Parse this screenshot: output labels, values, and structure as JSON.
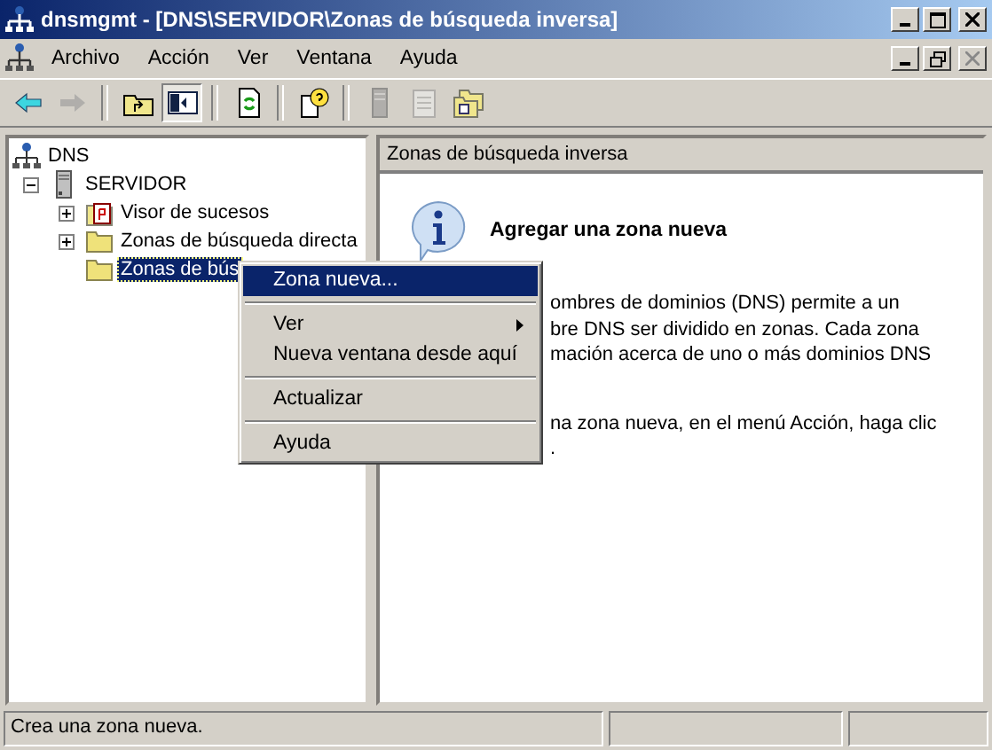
{
  "window": {
    "title": "dnsmgmt - [DNS\\SERVIDOR\\Zonas de búsqueda inversa]"
  },
  "menu_bar": [
    {
      "label": "Archivo"
    },
    {
      "label": "Acción"
    },
    {
      "label": "Ver"
    },
    {
      "label": "Ventana"
    },
    {
      "label": "Ayuda"
    }
  ],
  "toolbar": [
    {
      "kind": "back",
      "disabled": false,
      "pressed": false
    },
    {
      "kind": "forward",
      "disabled": true,
      "pressed": false
    },
    {
      "kind": "sep"
    },
    {
      "kind": "up",
      "disabled": false,
      "pressed": false
    },
    {
      "kind": "tree",
      "disabled": false,
      "pressed": true
    },
    {
      "kind": "sep"
    },
    {
      "kind": "refresh",
      "disabled": false,
      "pressed": false
    },
    {
      "kind": "sep"
    },
    {
      "kind": "help",
      "disabled": false,
      "pressed": false
    },
    {
      "kind": "sep"
    },
    {
      "kind": "server",
      "disabled": true,
      "pressed": false
    },
    {
      "kind": "doc",
      "disabled": true,
      "pressed": false
    },
    {
      "kind": "folders",
      "disabled": false,
      "pressed": false
    }
  ],
  "tree": [
    {
      "label": "DNS",
      "kind": "network",
      "selected": false,
      "children": [
        {
          "label": "SERVIDOR",
          "kind": "server",
          "expanded": true,
          "selected": false,
          "children": [
            {
              "label": "Visor de sucesos",
              "kind": "events",
              "expanded": false,
              "selected": false
            },
            {
              "label": "Zonas de búsqueda directa",
              "kind": "folder",
              "expanded": false,
              "selected": false
            },
            {
              "label": "Zonas de bús",
              "kind": "folder",
              "selected": true
            }
          ]
        }
      ]
    }
  ],
  "pane": {
    "header": "Zonas de búsqueda inversa",
    "heading": "Agregar una zona nueva",
    "paragraphs": [
      [
        "ombres de dominios (DNS) permite a un",
        "bre DNS ser dividido en zonas. Cada zona",
        "mación acerca de uno o más dominios DNS"
      ],
      [
        "na zona nueva, en el menú Acción, haga clic",
        "."
      ]
    ]
  },
  "context_menu": [
    {
      "kind": "item",
      "label": "Zona nueva...",
      "selected": true,
      "submenu": false
    },
    {
      "kind": "sep"
    },
    {
      "kind": "item",
      "label": "Ver",
      "selected": false,
      "submenu": true
    },
    {
      "kind": "item",
      "label": "Nueva ventana desde aquí",
      "selected": false,
      "submenu": false
    },
    {
      "kind": "sep"
    },
    {
      "kind": "item",
      "label": "Actualizar",
      "selected": false,
      "submenu": false
    },
    {
      "kind": "sep"
    },
    {
      "kind": "item",
      "label": "Ayuda",
      "selected": false,
      "submenu": false
    }
  ],
  "status_bar": [
    "Crea una zona nueva."
  ]
}
